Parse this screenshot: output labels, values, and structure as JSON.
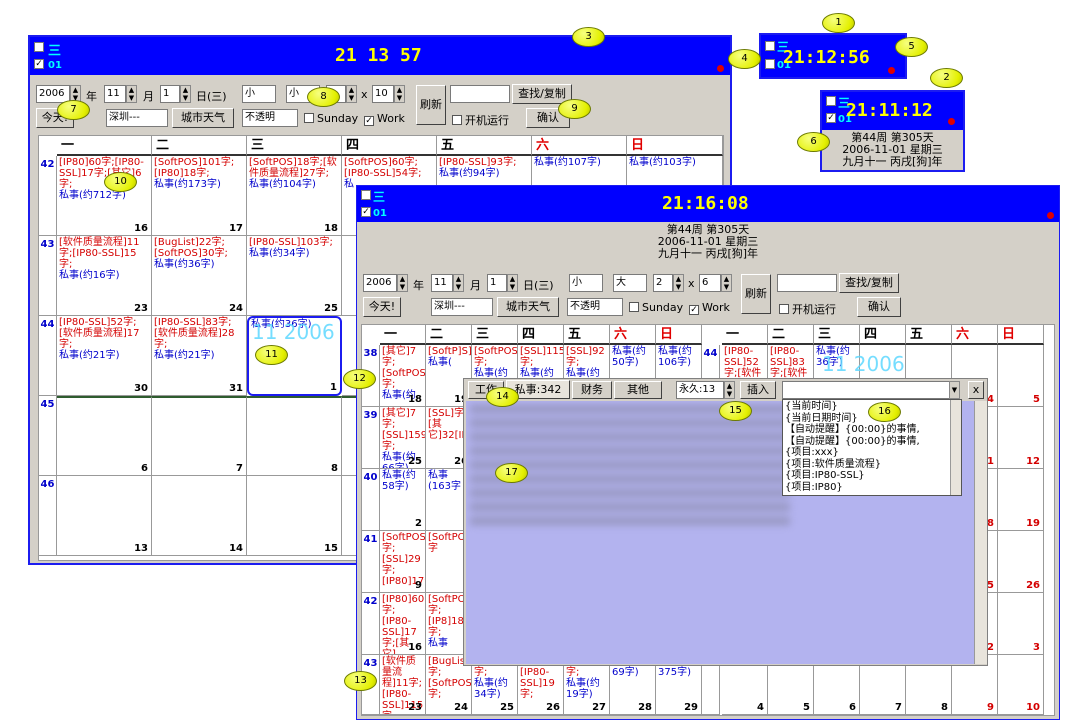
{
  "clocks": {
    "c1": "21:12:56",
    "c2": "21:11:12",
    "c3": "21:16:08",
    "main": "21 13 57"
  },
  "cell_label": "三",
  "cell_num": "01",
  "info": {
    "week": "第44周 第305天",
    "date": "2006-11-01 星期三",
    "lunar": "九月十一 丙戌[狗]年"
  },
  "markers": [
    "1",
    "2",
    "3",
    "4",
    "5",
    "6",
    "7",
    "8",
    "9",
    "10",
    "11",
    "12",
    "13",
    "14",
    "15",
    "16",
    "17"
  ],
  "toolbar": {
    "year": "2006",
    "year_unit": "年",
    "month": "11",
    "month_unit": "月",
    "day": "1",
    "day_unit": "日(三)",
    "size1": "小",
    "size2": "小",
    "size2b": "大",
    "rows": "2",
    "cols": "10",
    "cols2": "6",
    "x": "x",
    "refresh": "刷新",
    "search_btn": "查找/复制",
    "today": "今天!",
    "city": "深圳---",
    "weather": "城市天气",
    "opacity": "不透明",
    "sunday": "Sunday",
    "work": "Work",
    "startup": "开机运行",
    "confirm": "确认"
  },
  "weekdays": [
    "一",
    "二",
    "三",
    "四",
    "五",
    "六",
    "日"
  ],
  "weeks": [
    "42",
    "43",
    "44",
    "45",
    "46"
  ],
  "cells": [
    [
      {
        "r": "[IP80]60字;[IP80-SSL]17字;[其它]6字;",
        "b": "私事(约712字)",
        "d": "16"
      },
      {
        "r": "[SoftPOS]101字;[IP80]18字;",
        "b": "私事(约173字)",
        "d": "17"
      },
      {
        "r": "[SoftPOS]18字;[软件质量流程]27字;",
        "b": "私事(约104字)",
        "d": "18"
      },
      {
        "r": "[SoftPOS]60字;[IP80-SSL]54字;",
        "b": "私",
        "d": ""
      },
      {
        "r": "[IP80-SSL]93字;",
        "b": "私事(约94字)",
        "d": ""
      },
      {
        "r": "",
        "b": "私事(约107字)",
        "d": ""
      },
      {
        "r": "",
        "b": "私事(约103字)",
        "d": ""
      }
    ],
    [
      {
        "r": "[软件质量流程]11字;[IP80-SSL]15字;",
        "b": "私事(约16字)",
        "d": "23"
      },
      {
        "r": "[BugList]22字;[SoftPOS]30字;",
        "b": "私事(约36字)",
        "d": "24"
      },
      {
        "r": "[IP80-SSL]103字;",
        "b": "私事(约34字)",
        "d": "25"
      },
      {
        "r": "",
        "b": "",
        "d": ""
      },
      {
        "r": "",
        "b": "",
        "d": ""
      },
      {
        "r": "",
        "b": "",
        "d": ""
      },
      {
        "r": "",
        "b": "",
        "d": ""
      }
    ],
    [
      {
        "r": "[IP80-SSL]52字;[软件质量流程]17字;",
        "b": "私事(约21字)",
        "d": "30"
      },
      {
        "r": "[IP80-SSL]83字;[软件质量流程]28字;",
        "b": "私事(约21字)",
        "d": "31"
      },
      {
        "r": "",
        "b": "私事(约36字)",
        "d": "1"
      },
      {
        "r": "",
        "b": "",
        "d": ""
      },
      {
        "r": "",
        "b": "",
        "d": ""
      },
      {
        "r": "",
        "b": "",
        "d": ""
      },
      {
        "r": "",
        "b": "",
        "d": ""
      }
    ],
    [
      {
        "r": "",
        "b": "",
        "d": "6"
      },
      {
        "r": "",
        "b": "",
        "d": "7"
      },
      {
        "r": "",
        "b": "",
        "d": "8"
      },
      {
        "r": "",
        "b": "",
        "d": ""
      },
      {
        "r": "",
        "b": "",
        "d": ""
      },
      {
        "r": "",
        "b": "",
        "d": ""
      },
      {
        "r": "",
        "b": "",
        "d": ""
      }
    ],
    [
      {
        "r": "",
        "b": "",
        "d": "13"
      },
      {
        "r": "",
        "b": "",
        "d": "14"
      },
      {
        "r": "",
        "b": "",
        "d": "15"
      },
      {
        "r": "",
        "b": "",
        "d": ""
      },
      {
        "r": "",
        "b": "",
        "d": ""
      },
      {
        "r": "",
        "b": "",
        "d": ""
      },
      {
        "r": "",
        "b": "",
        "d": ""
      }
    ]
  ],
  "watermark": "11 2006",
  "w2_weeks": [
    "38",
    "39",
    "40",
    "41",
    "42",
    "43"
  ],
  "w2_left": [
    [
      {
        "r": "[其它]7字;[SoftPOS]15字;",
        "b": "私事(约",
        "d": "18"
      },
      {
        "r": "[SoftP]S]1C[SSL]",
        "b": "私事(",
        "d": "19"
      },
      {
        "r": "[SoftPOS]32字;",
        "b": "私事(约",
        "d": ""
      },
      {
        "r": "[SSL]115字;",
        "b": "私事(约",
        "d": ""
      },
      {
        "r": "[SSL]92字;",
        "b": "私事(约",
        "d": ""
      },
      {
        "r": "",
        "b": "私事(约50字)",
        "d": ""
      },
      {
        "r": "",
        "b": "私事(约106字)",
        "d": ""
      }
    ],
    [
      {
        "r": "[其它]7字;[SSL]159字;",
        "b": "私事(约66字)",
        "d": "25"
      },
      {
        "r": "[SSL]字;[其它]32[IP8]",
        "b": "",
        "d": "26"
      },
      {
        "r": "",
        "b": "",
        "d": ""
      },
      {
        "r": "",
        "b": "",
        "d": ""
      },
      {
        "r": "",
        "b": "",
        "d": ""
      },
      {
        "r": "",
        "b": "",
        "d": ""
      },
      {
        "r": "",
        "b": "",
        "d": ""
      }
    ],
    [
      {
        "r": "",
        "b": "私事(约58字)",
        "d": "2"
      },
      {
        "r": "",
        "b": "私事(163字",
        "d": ""
      },
      {
        "r": "",
        "b": "",
        "d": ""
      },
      {
        "r": "",
        "b": "",
        "d": ""
      },
      {
        "r": "",
        "b": "",
        "d": ""
      },
      {
        "r": "",
        "b": "",
        "d": ""
      },
      {
        "r": "",
        "b": "",
        "d": ""
      }
    ],
    [
      {
        "r": "[SoftPOS]15字;[SSL]29字;[IP80]179",
        "b": "",
        "d": "9"
      },
      {
        "r": "[SoftPOS]83字",
        "b": "",
        "d": ""
      },
      {
        "r": "",
        "b": "",
        "d": ""
      },
      {
        "r": "",
        "b": "",
        "d": ""
      },
      {
        "r": "",
        "b": "",
        "d": ""
      },
      {
        "r": "",
        "b": "",
        "d": ""
      },
      {
        "r": "",
        "b": "",
        "d": ""
      }
    ],
    [
      {
        "r": "[IP80]60字;[IP80-SSL]17字;[其它]",
        "b": "",
        "d": "16"
      },
      {
        "r": "[SoftPOS]101字;[IP8]18字;",
        "b": "私事",
        "d": ""
      },
      {
        "r": "",
        "b": "",
        "d": ""
      },
      {
        "r": "",
        "b": "",
        "d": ""
      },
      {
        "r": "",
        "b": "",
        "d": ""
      },
      {
        "r": "",
        "b": "",
        "d": ""
      },
      {
        "r": "",
        "b": "",
        "d": ""
      }
    ],
    [
      {
        "r": "[软件质量流程]11字;[IP80-SSL]115字",
        "b": "",
        "d": "23"
      },
      {
        "r": "[BugList]22字;[SoftPOS]30字;",
        "b": "",
        "d": "24"
      },
      {
        "r": "[SSL]103字;",
        "b": "私事(约34字)",
        "d": "25"
      },
      {
        "r": "字;[IP80-SSL]19字;",
        "b": "",
        "d": "26"
      },
      {
        "r": "[SSL]22字;",
        "b": "私事(约19字)",
        "d": "27"
      },
      {
        "r": "",
        "b": "私事(约69字)",
        "d": "28"
      },
      {
        "r": "",
        "b": "私事(约375字)",
        "d": "29"
      }
    ]
  ],
  "w2_right_nums": [
    [
      "",
      "",
      "",
      "",
      "",
      "4",
      "5"
    ],
    [
      "",
      "",
      "",
      "",
      "",
      "11",
      "12"
    ],
    [
      "",
      "",
      "",
      "",
      "",
      "18",
      "19"
    ],
    [
      "",
      "",
      "",
      "",
      "",
      "25",
      "26"
    ],
    [
      "",
      "",
      "",
      "",
      "",
      "2",
      "3"
    ],
    [
      "4",
      "5",
      "6",
      "7",
      "8",
      "9",
      "10"
    ]
  ],
  "w2_right_first": {
    "r": "[IP80-SSL]52字;[软件",
    "b": "",
    "r2": "[IP80-SSL]83字;[软件",
    "b2": "私事(约36字)"
  },
  "tabs": {
    "t1": "工作",
    "t2": "私事:342",
    "t3": "财务",
    "t4": "其他",
    "keep": "永久:13",
    "insert": "插入",
    "close": "x"
  },
  "menu": [
    "{当前时间}",
    "{当前日期时间}",
    "【自动提醒】{00:00}的事情,",
    "【自动提醒】{00:00}的事情,",
    "{项目:xxx}",
    "{项目:软件质量流程}",
    "{项目:IP80-SSL}",
    "{项目:IP80}"
  ]
}
